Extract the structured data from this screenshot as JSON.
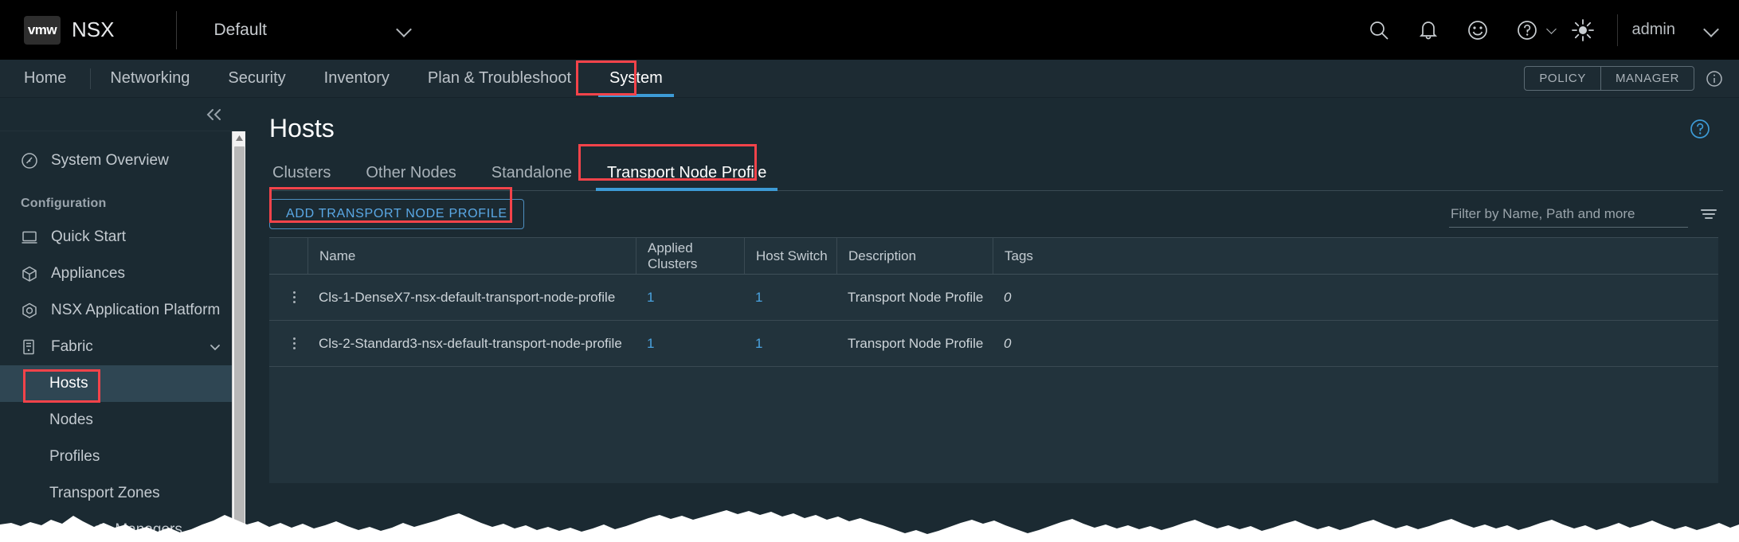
{
  "header": {
    "logo_text": "vmw",
    "product_name": "NSX",
    "workspace": "Default",
    "username": "admin",
    "icons": [
      {
        "name": "search-icon"
      },
      {
        "name": "bell-icon"
      },
      {
        "name": "smiley-icon"
      },
      {
        "name": "help-circle-icon"
      },
      {
        "name": "sun-icon"
      }
    ]
  },
  "nav": {
    "items": [
      {
        "label": "Home",
        "active": false
      },
      {
        "label": "Networking",
        "active": false
      },
      {
        "label": "Security",
        "active": false
      },
      {
        "label": "Inventory",
        "active": false
      },
      {
        "label": "Plan & Troubleshoot",
        "active": false
      },
      {
        "label": "System",
        "active": true
      }
    ],
    "mode_toggle": {
      "policy": "POLICY",
      "manager": "MANAGER"
    }
  },
  "sidebar": {
    "overview": {
      "label": "System Overview",
      "icon": "dashboard-icon"
    },
    "group_title": "Configuration",
    "items": [
      {
        "label": "Quick Start",
        "icon": "monitor-icon"
      },
      {
        "label": "Appliances",
        "icon": "cube-icon"
      },
      {
        "label": "NSX Application Platform",
        "icon": "hexagon-icon"
      },
      {
        "label": "Fabric",
        "icon": "server-icon",
        "expandable": true
      }
    ],
    "fabric_children": [
      {
        "label": "Hosts",
        "selected": true
      },
      {
        "label": "Nodes",
        "selected": false
      },
      {
        "label": "Profiles",
        "selected": false
      },
      {
        "label": "Transport Zones",
        "selected": false
      },
      {
        "label": "Compute Managers",
        "selected": false
      }
    ]
  },
  "main": {
    "page_title": "Hosts",
    "tabs": [
      {
        "label": "Clusters",
        "active": false
      },
      {
        "label": "Other Nodes",
        "active": false
      },
      {
        "label": "Standalone",
        "active": false
      },
      {
        "label": "Transport Node Profile",
        "active": true
      }
    ],
    "add_button_label": "ADD TRANSPORT NODE PROFILE",
    "filter_placeholder": "Filter by Name, Path and more",
    "filter_value": "",
    "table": {
      "columns": [
        "Name",
        "Applied Clusters",
        "Host Switch",
        "Description",
        "Tags"
      ],
      "rows": [
        {
          "name": "Cls-1-DenseX7-nsx-default-transport-node-profile",
          "applied_clusters": "1",
          "host_switch": "1",
          "description": "Transport Node Profile",
          "tags": "0"
        },
        {
          "name": "Cls-2-Standard3-nsx-default-transport-node-profile",
          "applied_clusters": "1",
          "host_switch": "1",
          "description": "Transport Node Profile",
          "tags": "0"
        }
      ]
    }
  },
  "colors": {
    "accent_blue": "#3d9bd6",
    "link_blue": "#4aa3e0",
    "annotation_red": "#f4434a",
    "selected_row": "#2f4653",
    "table_bg": "#22333c"
  }
}
